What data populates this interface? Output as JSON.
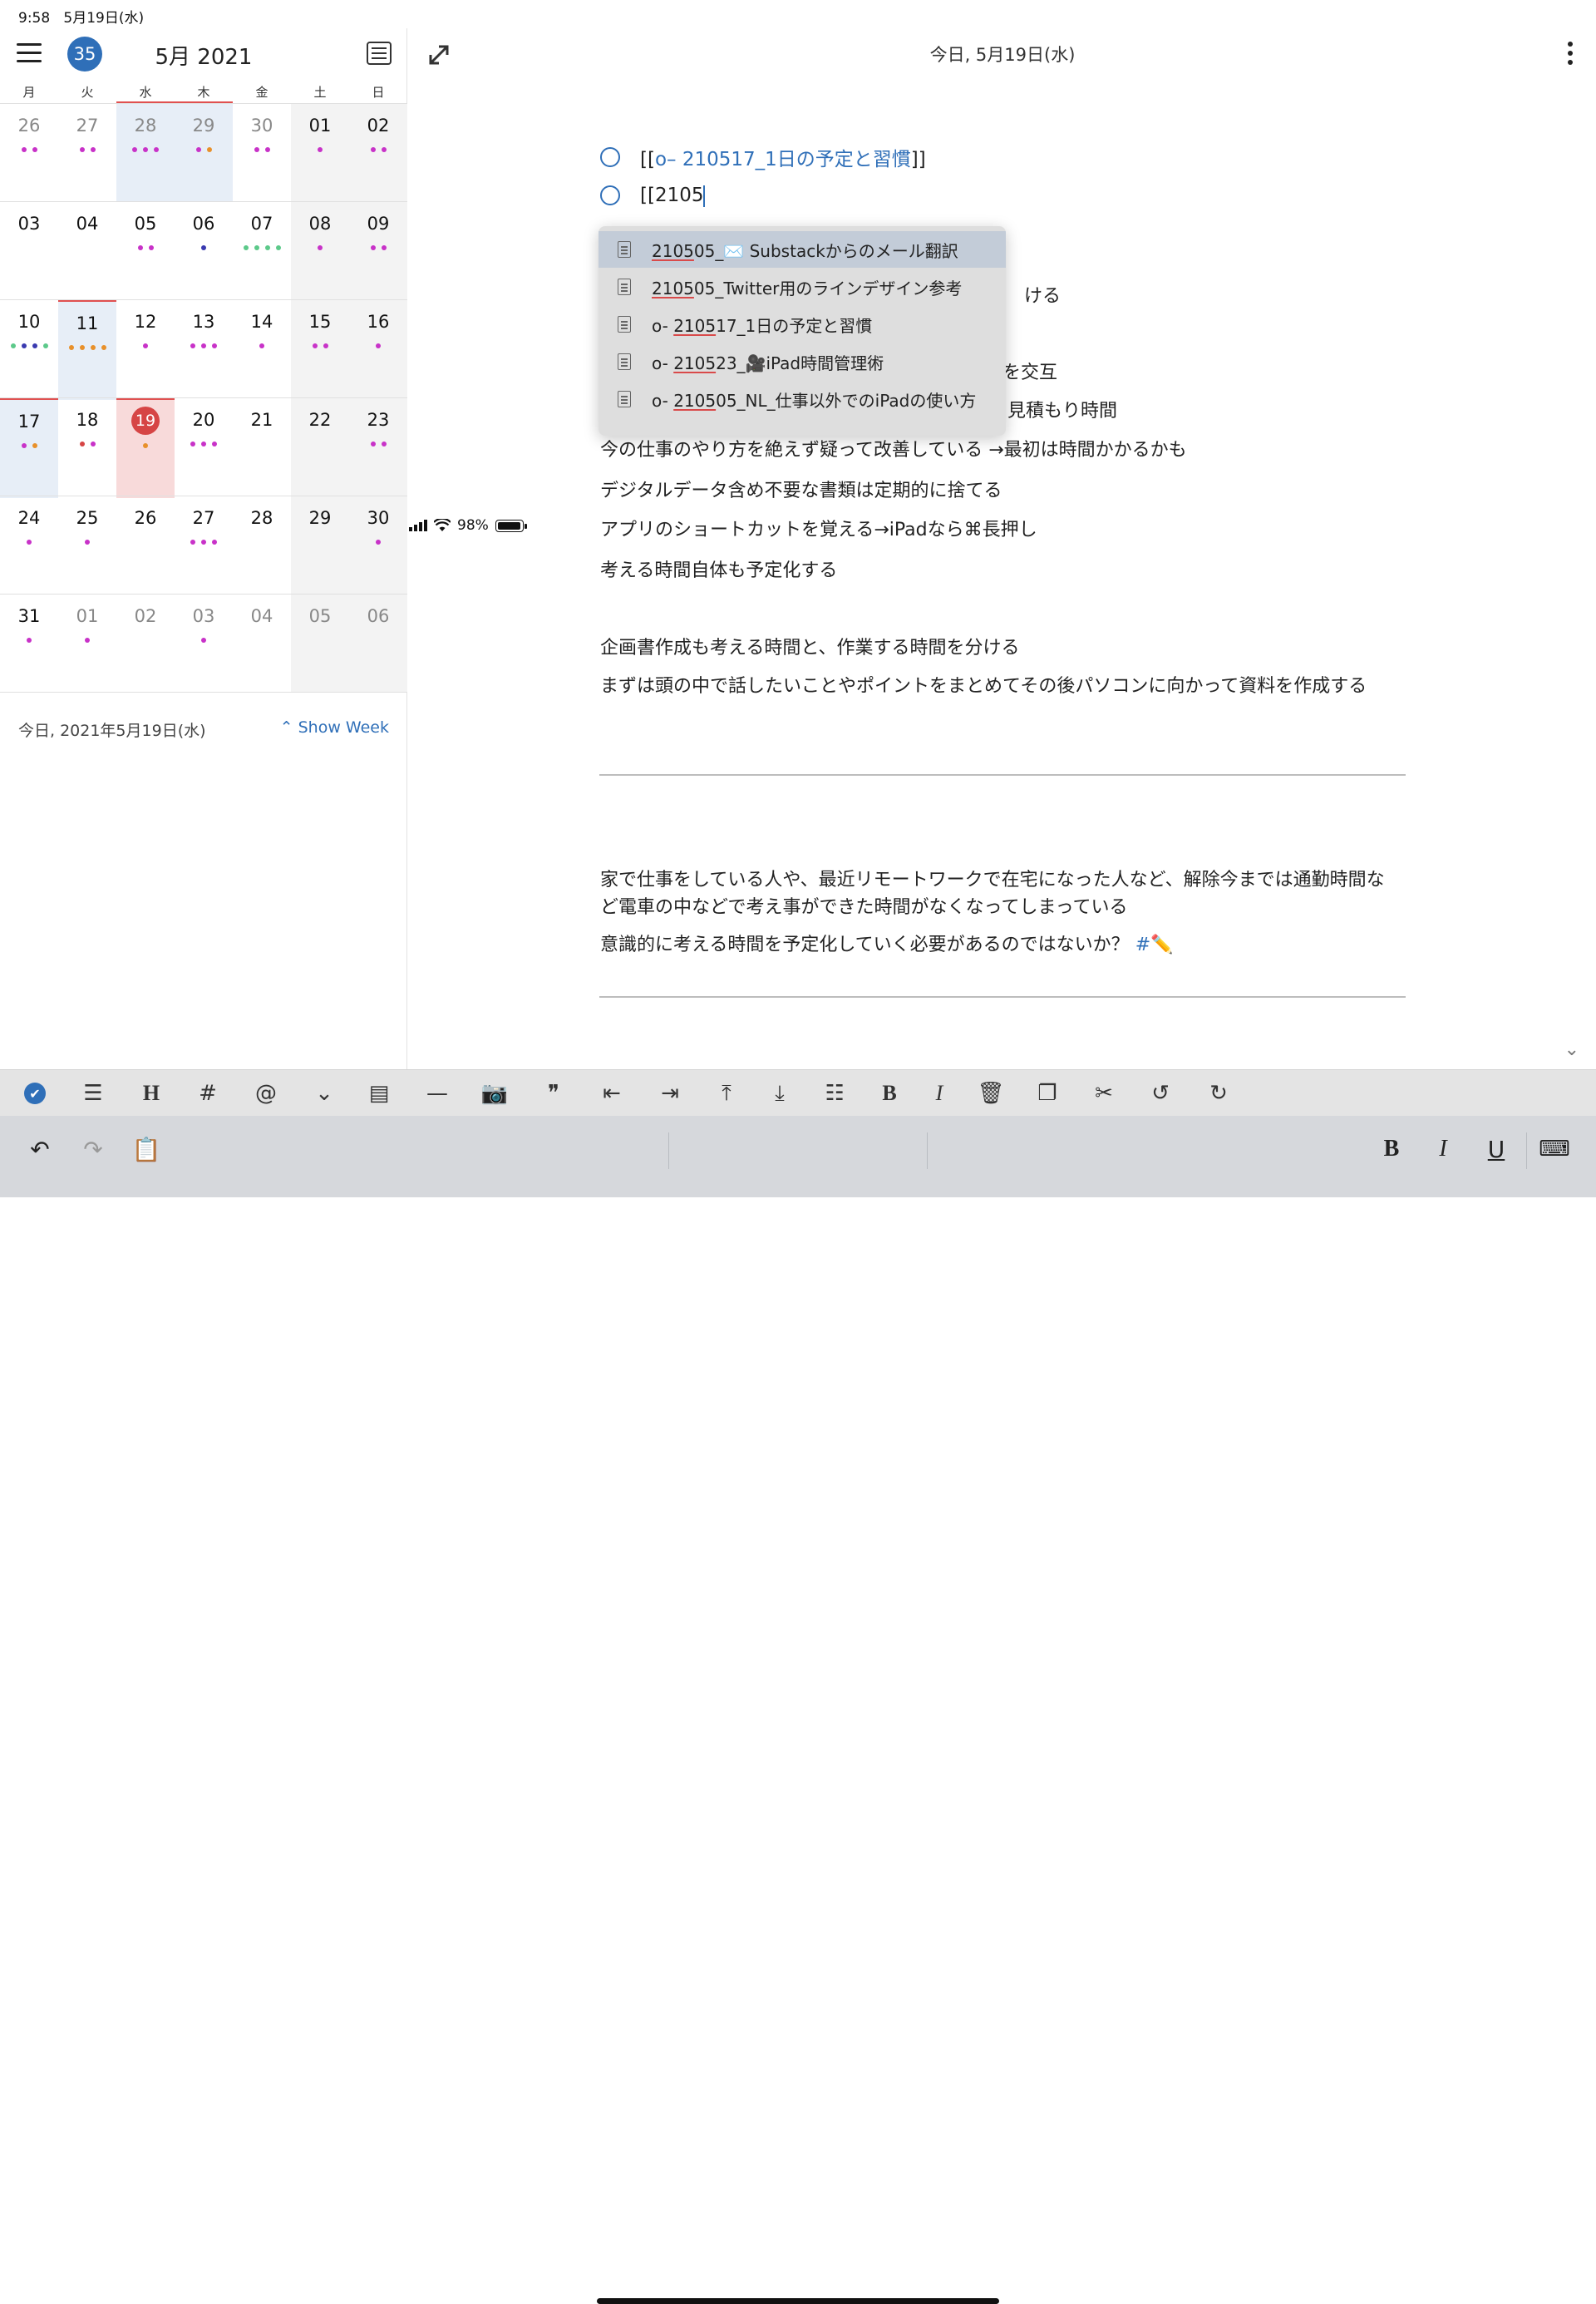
{
  "status": {
    "time": "9:58",
    "date": "5月19日(水)",
    "battery": "98%"
  },
  "calendar": {
    "week_number": "35",
    "month_title": "5月 2021",
    "weekdays": [
      "月",
      "火",
      "水",
      "木",
      "金",
      "土",
      "日"
    ],
    "footer_date": "今日, 2021年5月19日(水)",
    "show_week": "Show Week",
    "weeks": [
      [
        {
          "d": "26",
          "dim": true,
          "dots": [
            "#c832c8",
            "#c832c8"
          ]
        },
        {
          "d": "27",
          "dim": true,
          "dots": [
            "#c832c8",
            "#c832c8"
          ]
        },
        {
          "d": "28",
          "dim": true,
          "sel": true,
          "dots": [
            "#c832c8",
            "#c832c8",
            "#c832c8"
          ]
        },
        {
          "d": "29",
          "dim": true,
          "sel": true,
          "dots": [
            "#c832c8",
            "#e8902a"
          ]
        },
        {
          "d": "30",
          "dim": true,
          "dots": [
            "#c832c8",
            "#c832c8"
          ]
        },
        {
          "d": "01",
          "dots": [
            "#c832c8"
          ]
        },
        {
          "d": "02",
          "dots": [
            "#c832c8",
            "#c832c8"
          ]
        }
      ],
      [
        {
          "d": "03",
          "dots": []
        },
        {
          "d": "04",
          "dots": []
        },
        {
          "d": "05",
          "dots": [
            "#c832c8",
            "#c832c8"
          ]
        },
        {
          "d": "06",
          "dots": [
            "#3a3ab0"
          ]
        },
        {
          "d": "07",
          "dots": [
            "#5cc98a",
            "#5cc98a",
            "#5cc98a",
            "#5cc98a"
          ]
        },
        {
          "d": "08",
          "dots": [
            "#c832c8"
          ]
        },
        {
          "d": "09",
          "dots": [
            "#c832c8",
            "#c832c8"
          ]
        }
      ],
      [
        {
          "d": "10",
          "dots": [
            "#5cc98a",
            "#3a3ab0",
            "#3a3ab0",
            "#5cc98a"
          ]
        },
        {
          "d": "11",
          "sel": true,
          "dots": [
            "#e8902a",
            "#e8902a",
            "#e8902a",
            "#e8902a"
          ]
        },
        {
          "d": "12",
          "dots": [
            "#c832c8"
          ]
        },
        {
          "d": "13",
          "dots": [
            "#c832c8",
            "#c832c8",
            "#c832c8"
          ]
        },
        {
          "d": "14",
          "dots": [
            "#c832c8"
          ]
        },
        {
          "d": "15",
          "dots": [
            "#c832c8",
            "#c832c8"
          ]
        },
        {
          "d": "16",
          "dots": [
            "#c832c8"
          ]
        }
      ],
      [
        {
          "d": "17",
          "sel": true,
          "dots": [
            "#c832c8",
            "#e8902a"
          ]
        },
        {
          "d": "18",
          "dots": [
            "#d64545",
            "#c832c8"
          ]
        },
        {
          "d": "19",
          "today": true,
          "dots": [
            "#e8902a"
          ]
        },
        {
          "d": "20",
          "dots": [
            "#c832c8",
            "#c832c8",
            "#c832c8"
          ]
        },
        {
          "d": "21",
          "dots": []
        },
        {
          "d": "22",
          "dots": []
        },
        {
          "d": "23",
          "dots": [
            "#c832c8",
            "#c832c8"
          ]
        }
      ],
      [
        {
          "d": "24",
          "dots": [
            "#c832c8"
          ]
        },
        {
          "d": "25",
          "dots": [
            "#c832c8"
          ]
        },
        {
          "d": "26",
          "dots": []
        },
        {
          "d": "27",
          "dots": [
            "#c832c8",
            "#c832c8",
            "#c832c8"
          ]
        },
        {
          "d": "28",
          "dots": []
        },
        {
          "d": "29",
          "dots": []
        },
        {
          "d": "30",
          "dots": [
            "#c832c8"
          ]
        }
      ],
      [
        {
          "d": "31",
          "dots": [
            "#c832c8"
          ]
        },
        {
          "d": "01",
          "dim": true,
          "dots": [
            "#c832c8"
          ]
        },
        {
          "d": "02",
          "dim": true,
          "dots": []
        },
        {
          "d": "03",
          "dim": true,
          "dots": [
            "#c832c8"
          ]
        },
        {
          "d": "04",
          "dim": true,
          "dots": []
        },
        {
          "d": "05",
          "dim": true,
          "dots": []
        },
        {
          "d": "06",
          "dim": true,
          "dots": []
        }
      ]
    ]
  },
  "editor": {
    "title": "今日, 5月19日(水)",
    "task1_open": "[[",
    "task1_link": "o– 210517_1日の予定と習慣",
    "task1_close": "]]",
    "task2_text": "[[2105",
    "lines": {
      "partial1": "ける",
      "partial2": "務を交互",
      "partial3": "見積もり時間",
      "l1": "今の仕事のやり方を絶えず疑って改善している →最初は時間かかるかも",
      "l2": "デジタルデータ含め不要な書類は定期的に捨てる",
      "l3": "アプリのショートカットを覚える→iPadなら⌘長押し",
      "l4": "考える時間自体も予定化する",
      "l5": "企画書作成も考える時間と、作業する時間を分ける",
      "l6": "まずは頭の中で話したいことやポイントをまとめてその後パソコンに向かって資料を作成する",
      "l7": "家で仕事をしている人や、最近リモートワークで在宅になった人など、解除今までは通勤時間など電車の中などで考え事ができた時間がなくなってしまっている",
      "l8": "意識的に考える時間を予定化していく必要があるのではないか？",
      "l8_tag": "#✏️"
    },
    "suggestions": [
      {
        "pre": "",
        "hl": "2105",
        "post": "05_✉️ Substackからのメール翻訳"
      },
      {
        "pre": "",
        "hl": "2105",
        "post": "05_Twitter用のラインデザイン参考"
      },
      {
        "pre": "o- ",
        "hl": "2105",
        "post": "17_1日の予定と習慣"
      },
      {
        "pre": "o- ",
        "hl": "2105",
        "post": "23_🎥iPad時間管理術"
      },
      {
        "pre": "o- ",
        "hl": "2105",
        "post": "05_NL_仕事以外でのiPadの使い方"
      }
    ]
  },
  "toolbar": {
    "icons": [
      "checkbox-icon",
      "list-icon",
      "heading-icon",
      "hashtag-icon",
      "mention-icon",
      "collapse-icon",
      "document-icon",
      "horizontal-rule-icon",
      "camera-icon",
      "quote-icon",
      "outdent-icon",
      "indent-icon",
      "move-up-icon",
      "move-down-icon",
      "numbered-list-icon",
      "bold-icon",
      "italic-icon",
      "delete-icon",
      "copy-icon",
      "cut-icon",
      "undo-icon",
      "redo-icon"
    ],
    "glyphs": [
      "✔",
      "☰",
      "H",
      "#",
      "@",
      "⌄",
      "▤",
      "—",
      "📷",
      "❞",
      "⇤",
      "⇥",
      "⤒",
      "⤓",
      "☷",
      "B",
      "I",
      "🗑",
      "❐",
      "✂",
      "↺",
      "↻"
    ],
    "kb_bold": "B",
    "kb_italic": "I",
    "kb_underline": "U"
  }
}
